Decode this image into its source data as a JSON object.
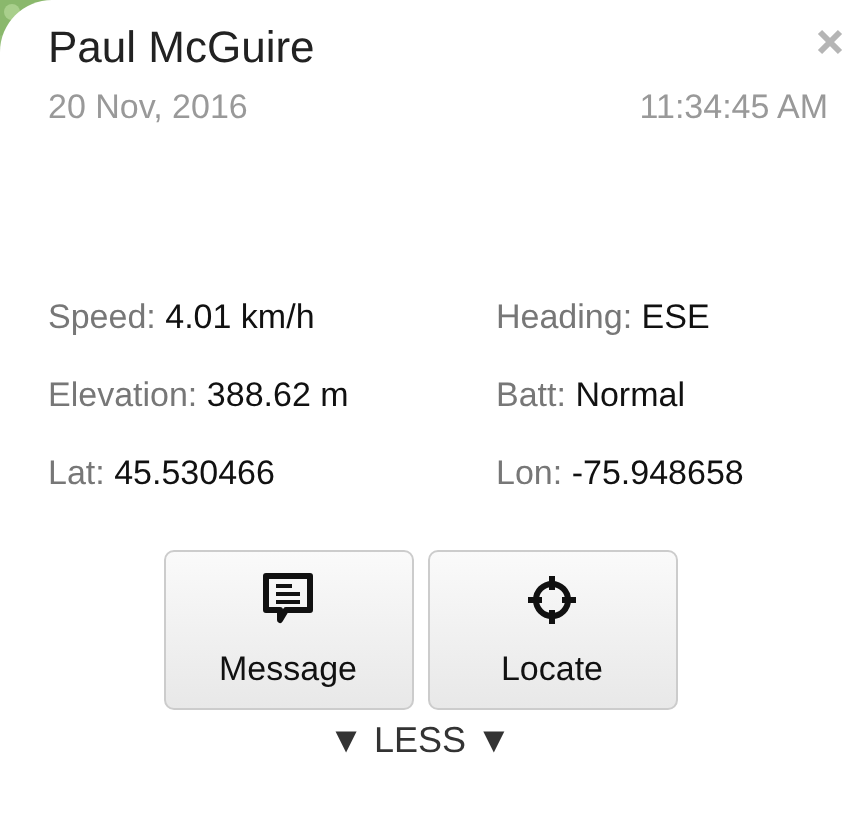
{
  "popup": {
    "title": "Paul McGuire",
    "date": "20 Nov, 2016",
    "time": "11:34:45 AM",
    "fields": [
      {
        "label": "Speed:",
        "value": "4.01 km/h"
      },
      {
        "label": "Heading:",
        "value": "ESE"
      },
      {
        "label": "Elevation:",
        "value": "388.62 m"
      },
      {
        "label": "Batt:",
        "value": "Normal"
      },
      {
        "label": "Lat:",
        "value": "45.530466"
      },
      {
        "label": "Lon:",
        "value": "-75.948658"
      }
    ],
    "buttons": [
      {
        "kind": "message",
        "label": "Message"
      },
      {
        "kind": "locate",
        "label": "Locate"
      }
    ],
    "toggle": "▼ LESS ▼"
  }
}
